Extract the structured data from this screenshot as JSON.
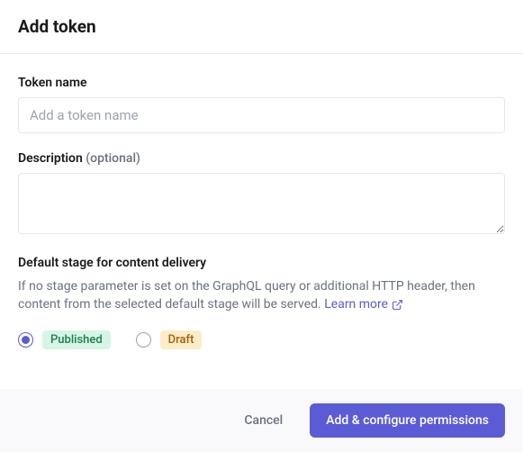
{
  "header": {
    "title": "Add token"
  },
  "fields": {
    "tokenName": {
      "label": "Token name",
      "placeholder": "Add a token name",
      "value": ""
    },
    "description": {
      "label": "Description",
      "optional": "(optional)",
      "value": ""
    },
    "defaultStage": {
      "label": "Default stage for content delivery",
      "help": "If no stage parameter is set on the GraphQL query or additional HTTP header, then content from the selected default stage will be served.",
      "learnMore": "Learn more",
      "options": [
        {
          "label": "Published",
          "selected": true
        },
        {
          "label": "Draft",
          "selected": false
        }
      ]
    }
  },
  "footer": {
    "cancel": "Cancel",
    "submit": "Add & configure permissions"
  }
}
